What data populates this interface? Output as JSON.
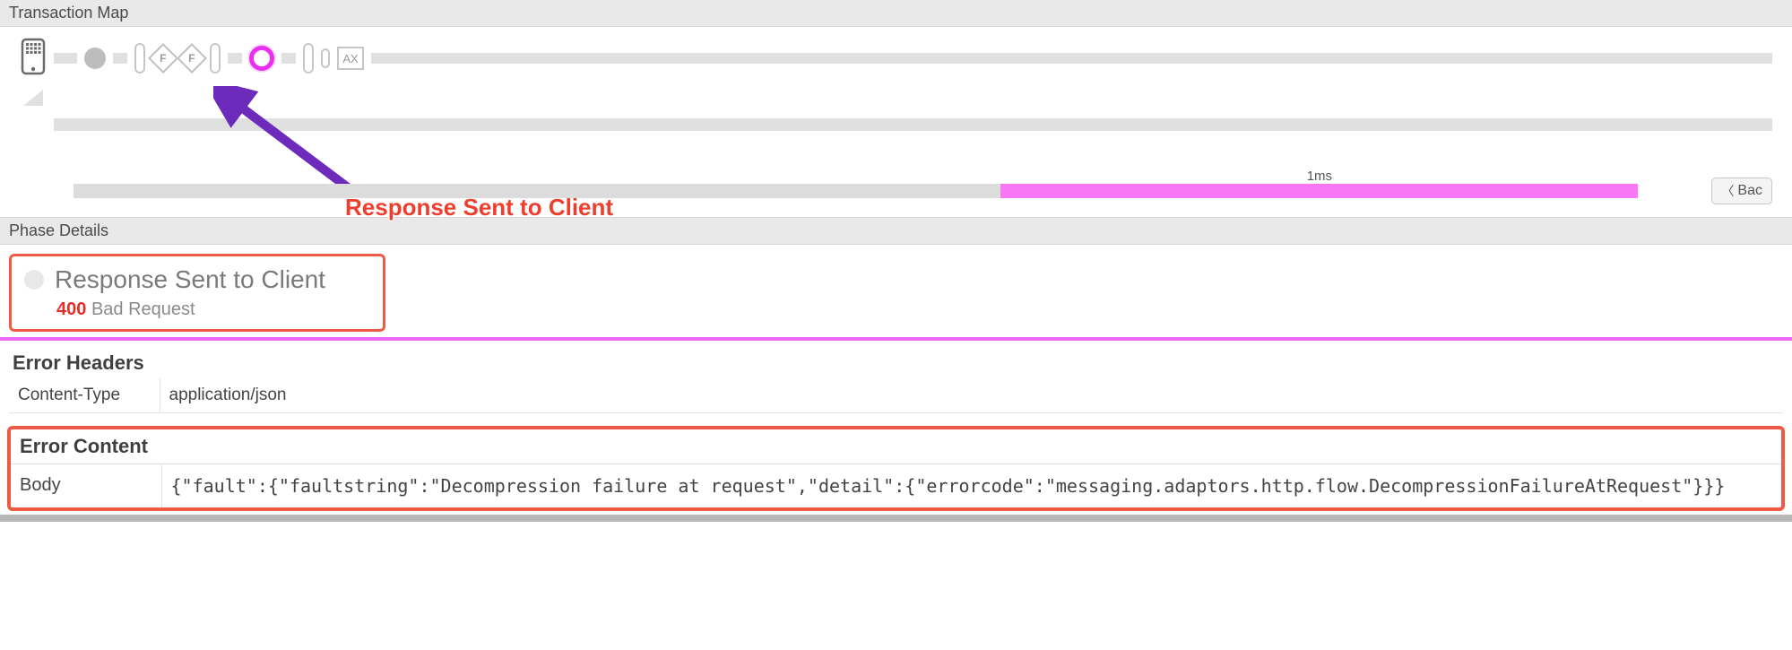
{
  "section_title": "Transaction Map",
  "flow": {
    "nodes": [
      {
        "type": "device"
      },
      {
        "type": "track",
        "w": 26
      },
      {
        "type": "circle"
      },
      {
        "type": "track",
        "w": 16
      },
      {
        "type": "pillar"
      },
      {
        "type": "diamond",
        "label": "F"
      },
      {
        "type": "diamond",
        "label": "F"
      },
      {
        "type": "pillar"
      },
      {
        "type": "track",
        "w": 16
      },
      {
        "type": "active"
      },
      {
        "type": "track",
        "w": 16
      },
      {
        "type": "pillar"
      },
      {
        "type": "pillar-small"
      },
      {
        "type": "ax",
        "label": "AX"
      },
      {
        "type": "track-flex"
      }
    ]
  },
  "annotation": {
    "label": "Response Sent to Client"
  },
  "timeline": {
    "grey_pct": 48,
    "pink_pct": 33,
    "time_label": "1ms",
    "back_label": "Bac"
  },
  "phase_section_title": "Phase Details",
  "phase": {
    "name": "Response Sent to Client",
    "status_code": "400",
    "status_text": "Bad Request"
  },
  "error_headers": {
    "heading": "Error Headers",
    "rows": [
      {
        "k": "Content-Type",
        "v": "application/json"
      }
    ]
  },
  "error_content": {
    "heading": "Error Content",
    "body_label": "Body",
    "body": "{\"fault\":{\"faultstring\":\"Decompression failure at request\",\"detail\":{\"errorcode\":\"messaging.adaptors.http.flow.DecompressionFailureAtRequest\"}}}"
  }
}
